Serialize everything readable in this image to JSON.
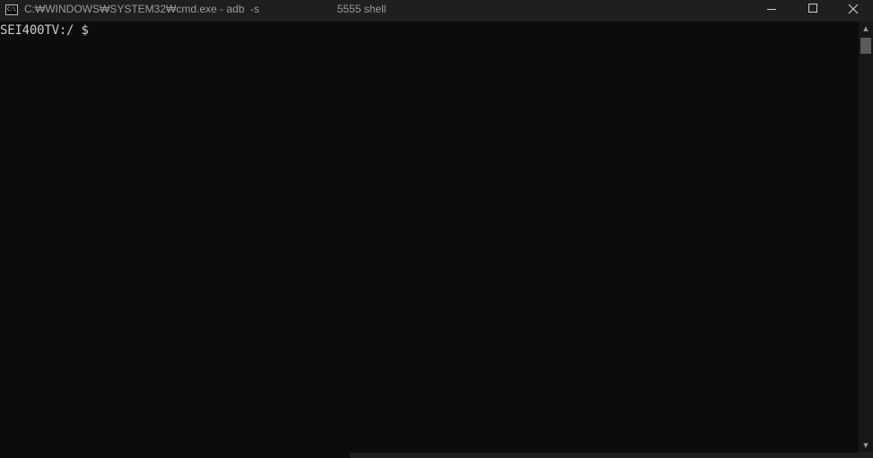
{
  "window": {
    "title": "C:₩WINDOWS₩SYSTEM32₩cmd.exe - adb  -s                          5555 shell",
    "icon": "cmd-icon",
    "icon_glyph": "C:\\",
    "controls": {
      "minimize": "minimize-icon",
      "maximize": "maximize-icon",
      "close": "close-icon"
    }
  },
  "console": {
    "prompt": "SEI400TV:/ $",
    "background": "#0c0c0c",
    "foreground": "#cccccc"
  },
  "scrollbar": {
    "up_arrow": "▲",
    "down_arrow": "▼"
  }
}
